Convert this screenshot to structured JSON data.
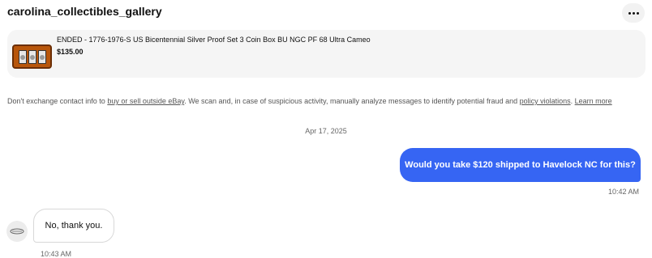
{
  "header": {
    "seller_name": "carolina_collectibles_gallery",
    "more_icon": "ellipsis-icon"
  },
  "item": {
    "title": "ENDED - 1776-1976-S US Bicentennial Silver Proof Set 3 Coin Box BU NGC PF 68 Ultra Cameo",
    "price": "$135.00",
    "thumbnail_icon": "coin-set-thumbnail"
  },
  "disclaimer": {
    "text_before": "Don't exchange contact info to ",
    "link1": "buy or sell outside eBay",
    "text_middle": ". We scan and, in case of suspicious activity, manually analyze messages to identify potential fraud and ",
    "link2": "policy violations",
    "text_after": ". ",
    "learn_more": "Learn more"
  },
  "conversation": {
    "date": "Apr 17, 2025",
    "messages": [
      {
        "direction": "outgoing",
        "text": "Would you take $120 shipped to Havelock NC for this?",
        "time": "10:42 AM"
      },
      {
        "direction": "incoming",
        "text": "No, thank you.",
        "time": "10:43 AM"
      }
    ]
  },
  "colors": {
    "accent_blue": "#3665f3",
    "card_bg": "#f5f5f5",
    "muted_text": "#666666"
  }
}
